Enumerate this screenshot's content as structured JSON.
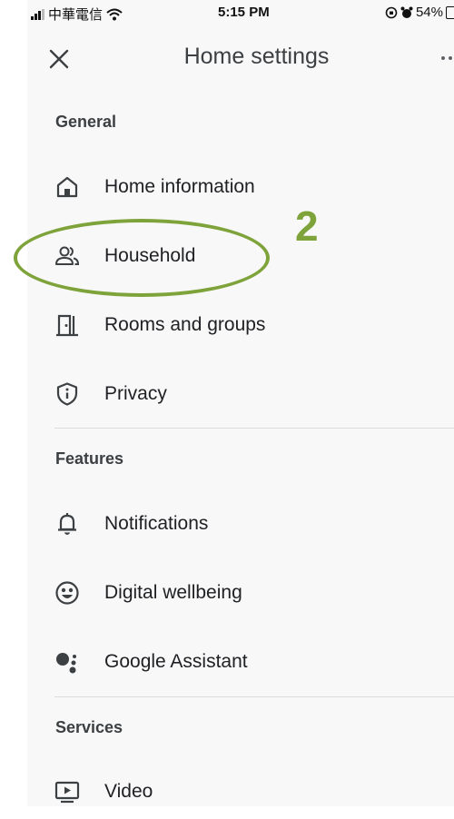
{
  "status_bar": {
    "carrier": "中華電信",
    "time": "5:15 PM",
    "battery": "54%"
  },
  "header": {
    "title": "Home settings",
    "close_icon": "close-icon",
    "more_icon": "more-options-icon"
  },
  "sections": [
    {
      "heading": "General",
      "items": [
        {
          "label": "Home information",
          "icon": "home-icon"
        },
        {
          "label": "Household",
          "icon": "people-icon"
        },
        {
          "label": "Rooms and groups",
          "icon": "door-icon"
        },
        {
          "label": "Privacy",
          "icon": "shield-info-icon"
        }
      ]
    },
    {
      "heading": "Features",
      "items": [
        {
          "label": "Notifications",
          "icon": "bell-icon"
        },
        {
          "label": "Digital wellbeing",
          "icon": "wellbeing-icon"
        },
        {
          "label": "Google Assistant",
          "icon": "assistant-icon"
        }
      ]
    },
    {
      "heading": "Services",
      "items": [
        {
          "label": "Video",
          "icon": "video-play-icon"
        }
      ]
    }
  ],
  "annotation": {
    "number": "2",
    "color": "#7ea33a"
  }
}
